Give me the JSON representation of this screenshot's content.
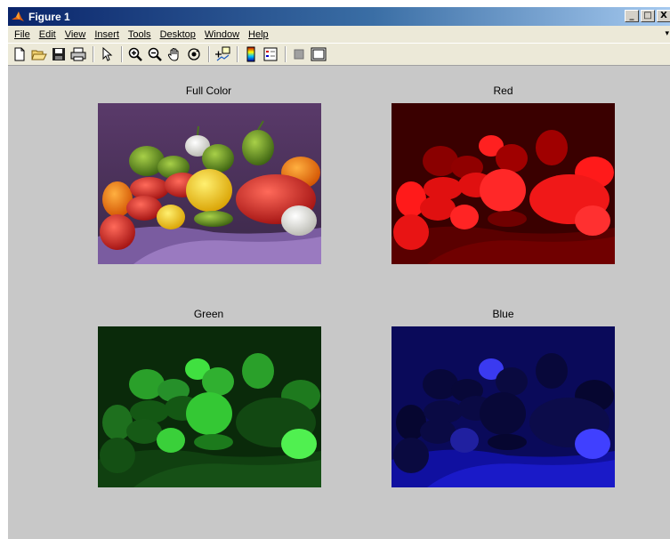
{
  "window": {
    "title": "Figure 1",
    "controls": {
      "minimize": "_",
      "maximize": "□",
      "close": "X"
    }
  },
  "menu": [
    {
      "label": "File"
    },
    {
      "label": "Edit"
    },
    {
      "label": "View"
    },
    {
      "label": "Insert"
    },
    {
      "label": "Tools"
    },
    {
      "label": "Desktop"
    },
    {
      "label": "Window"
    },
    {
      "label": "Help"
    }
  ],
  "menu_overflow": "▾",
  "toolbar": {
    "icons": [
      "new-figure-icon",
      "open-file-icon",
      "save-icon",
      "print-icon",
      "edit-plot-arrow-icon",
      "zoom-in-icon",
      "zoom-out-icon",
      "pan-hand-icon",
      "rotate-3d-icon",
      "data-cursor-icon",
      "colorbar-icon",
      "legend-icon",
      "hide-plot-tools-icon",
      "show-plot-tools-icon"
    ]
  },
  "plots": [
    {
      "title": "Full Color",
      "channel": "full",
      "tint": "#ffffff"
    },
    {
      "title": "Red",
      "channel": "red",
      "tint": "#ff0000"
    },
    {
      "title": "Green",
      "channel": "green",
      "tint": "#00ff00"
    },
    {
      "title": "Blue",
      "channel": "blue",
      "tint": "#0000ff"
    }
  ],
  "colors": {
    "figure_background": "#c8c8c8",
    "titlebar_start": "#0a246a",
    "titlebar_end": "#a6caf0"
  }
}
